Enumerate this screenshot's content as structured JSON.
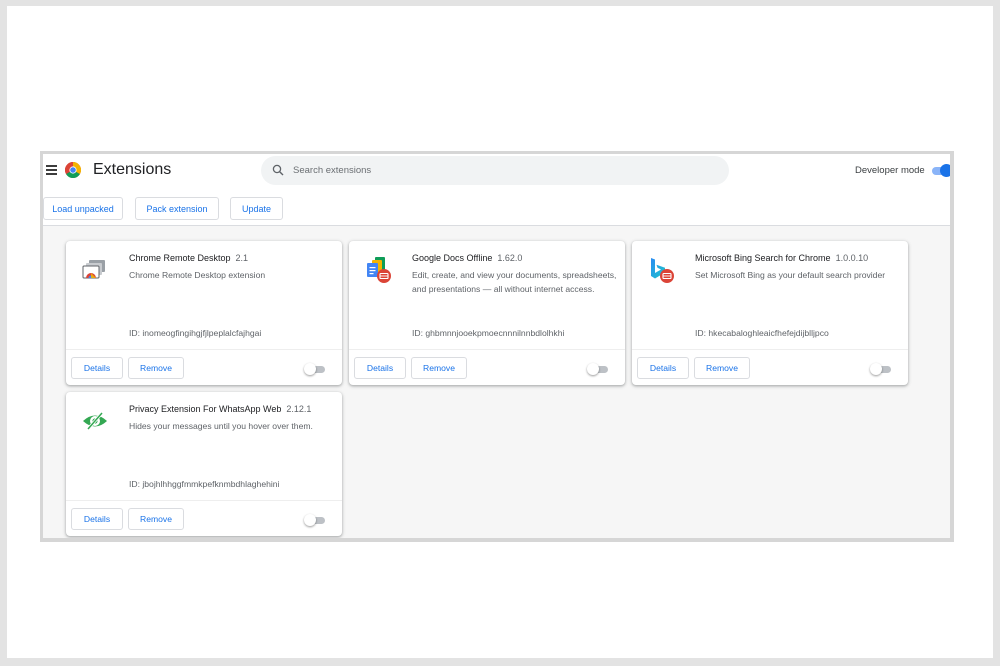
{
  "header": {
    "title": "Extensions",
    "search_placeholder": "Search extensions",
    "developer_mode_label": "Developer mode",
    "developer_mode_on": true,
    "accent_color": "#1a73e8"
  },
  "toolbar": {
    "load_unpacked_label": "Load unpacked",
    "pack_extension_label": "Pack extension",
    "update_label": "Update"
  },
  "extensions": [
    {
      "name": "Chrome Remote Desktop",
      "version": "2.1",
      "description": "Chrome Remote Desktop extension",
      "id_text": "ID: inomeogfingihgjfjlpeplalcfajhgai",
      "icon": "chrome-remote-desktop-icon",
      "details_label": "Details",
      "remove_label": "Remove",
      "enabled": false
    },
    {
      "name": "Google Docs Offline",
      "version": "1.62.0",
      "description": "Edit, create, and view your documents, spreadsheets, and presentations — all without internet access.",
      "id_text": "ID: ghbmnnjooekpmoecnnnilnnbdlolhkhi",
      "icon": "google-docs-offline-icon",
      "details_label": "Details",
      "remove_label": "Remove",
      "enabled": false
    },
    {
      "name": "Microsoft Bing Search for Chrome",
      "version": "1.0.0.10",
      "description": "Set Microsoft Bing as your default search provider",
      "id_text": "ID: hkecabaloghleaicfhefejdijblljpco",
      "icon": "bing-icon",
      "details_label": "Details",
      "remove_label": "Remove",
      "enabled": false
    },
    {
      "name": "Privacy Extension For WhatsApp Web",
      "version": "2.12.1",
      "description": "Hides your messages until you hover over them.",
      "id_text": "ID: jbojhlhhggfmmkpefknmbdhlaghehini",
      "icon": "privacy-eye-icon",
      "details_label": "Details",
      "remove_label": "Remove",
      "enabled": false
    }
  ]
}
